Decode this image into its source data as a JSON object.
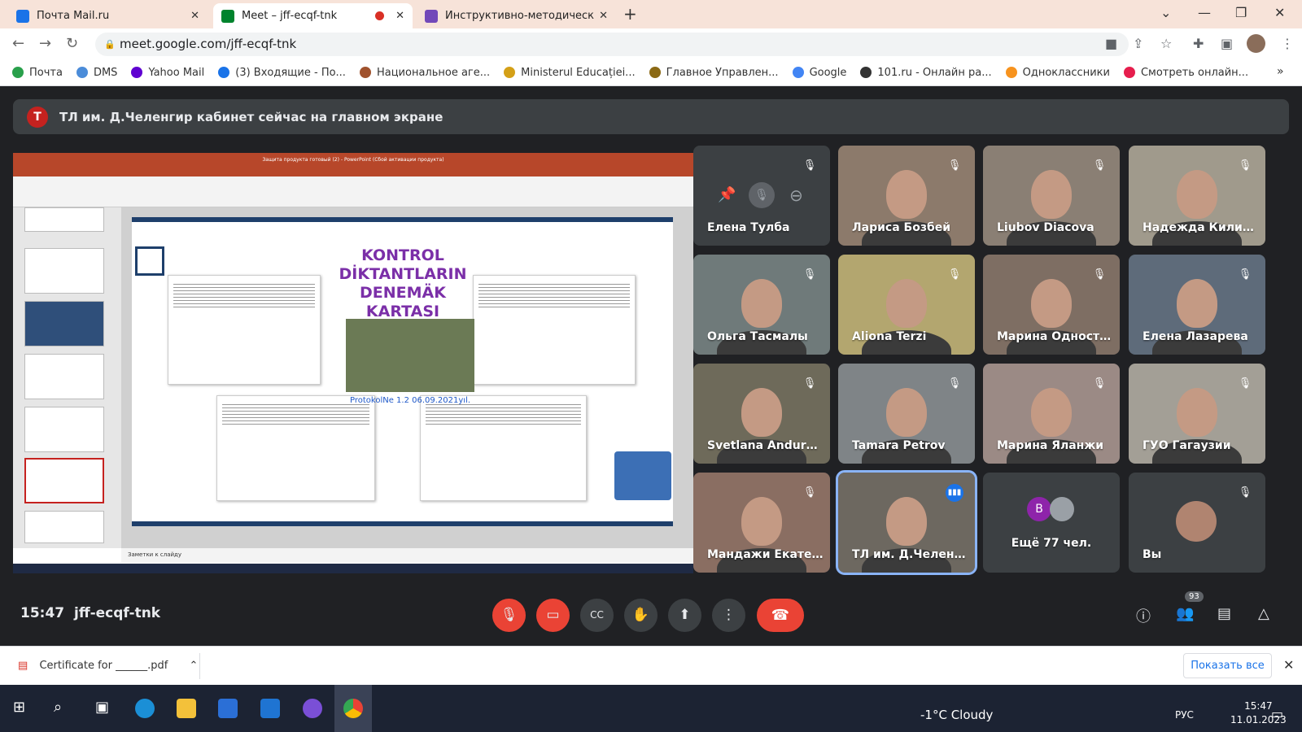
{
  "tabs": [
    {
      "title": "Почта Mail.ru",
      "color": "#1a73e8"
    },
    {
      "title": "Meet – jff-ecqf-tnk",
      "color": "#00832d"
    },
    {
      "title": "Инструктивно-методический се",
      "color": "#7248b9"
    }
  ],
  "address": {
    "url": "meet.google.com/jff-ecqf-tnk"
  },
  "bookmarks": [
    {
      "label": "Почта",
      "color": "#29a04b"
    },
    {
      "label": "DMS",
      "color": "#4b8cd9"
    },
    {
      "label": "Yahoo Mail",
      "color": "#5f01d1"
    },
    {
      "label": "(3) Входящие - По...",
      "color": "#1a73e8"
    },
    {
      "label": "Национальное аге...",
      "color": "#a0522d"
    },
    {
      "label": "Ministerul Educației...",
      "color": "#d4a017"
    },
    {
      "label": "Главное Управлен...",
      "color": "#8b6914"
    },
    {
      "label": "Google",
      "color": "#4285f4"
    },
    {
      "label": "101.ru - Онлайн ра...",
      "color": "#333333"
    },
    {
      "label": "Одноклассники",
      "color": "#f7931e"
    },
    {
      "label": "Смотреть онлайн...",
      "color": "#e61e4d"
    }
  ],
  "banner": {
    "initial": "Т",
    "text": "ТЛ им. Д.Челенгир кабинет сейчас на главном экране"
  },
  "presentation": {
    "window_title": "Защита продукта готовый (2) - PowerPoint (Сбой активации продукта)",
    "slide_title": "KONTROL DİKTANTLARIN DENEMÄK KARTASI",
    "protocol": "ProtokolNe 1.2   06.09.2021yıl.",
    "notes": "Заметки к слайду"
  },
  "participants": [
    {
      "name": "Елена Тулба",
      "muted": true,
      "bg": "#3c4043"
    },
    {
      "name": "Лариса Бозбей",
      "muted": true,
      "bg": "#8c7a6b"
    },
    {
      "name": "Liubov Diacova",
      "muted": true,
      "bg": "#8a7f74"
    },
    {
      "name": "Надежда Килим...",
      "muted": true,
      "bg": "#a09a8c"
    },
    {
      "name": "Ольга Тасмалы",
      "muted": true,
      "bg": "#6f7a7a"
    },
    {
      "name": "Aliona Terzi",
      "muted": true,
      "bg": "#b3a66f"
    },
    {
      "name": "Марина Односта...",
      "muted": true,
      "bg": "#7e6e63"
    },
    {
      "name": "Елена Лазарева",
      "muted": true,
      "bg": "#5e6b7a"
    },
    {
      "name": "Svetlana Andurova",
      "muted": true,
      "bg": "#6e6a5a"
    },
    {
      "name": "Tamara Petrov",
      "muted": true,
      "bg": "#7f8487"
    },
    {
      "name": "Марина Яланжи",
      "muted": true,
      "bg": "#9b8a85"
    },
    {
      "name": "ГУО Гагаузии",
      "muted": true,
      "bg": "#a39f96"
    },
    {
      "name": "Мандажи Екатер...",
      "muted": true,
      "bg": "#8a6e62"
    },
    {
      "name": "ТЛ им. Д.Челенг...",
      "muted": false,
      "bg": "#6d6860"
    },
    {
      "name": "Ещё 77 чел.",
      "muted": false,
      "bg": "#3c4043"
    },
    {
      "name": "Вы",
      "muted": true,
      "bg": "#3c4043"
    }
  ],
  "more_avatar_initial": "B",
  "controls": {
    "time": "15:47",
    "code": "jff-ecqf-tnk",
    "people_count": "93"
  },
  "download": {
    "file": "Certificate for ______.pdf",
    "show_all": "Показать все"
  },
  "taskbar": {
    "weather": "-1°C  Cloudy",
    "lang": "РУС",
    "time": "15:47",
    "date": "11.01.2023"
  }
}
